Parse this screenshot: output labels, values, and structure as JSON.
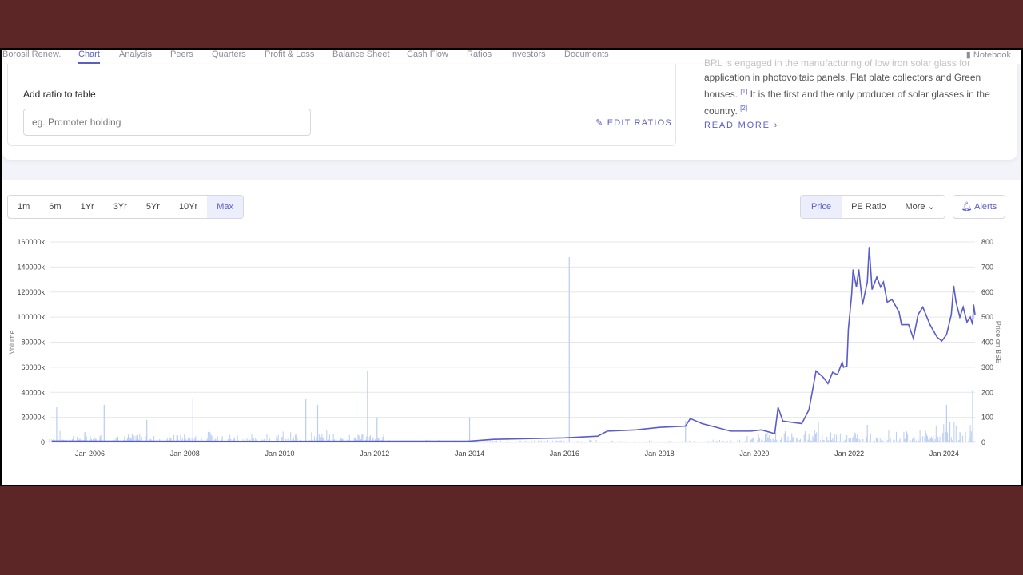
{
  "nav": {
    "items": [
      "Borosil Renew.",
      "Chart",
      "Analysis",
      "Peers",
      "Quarters",
      "Profit & Loss",
      "Balance Sheet",
      "Cash Flow",
      "Ratios",
      "Investors",
      "Documents"
    ],
    "active": "Chart",
    "notebook": "Notebook"
  },
  "ratio": {
    "label": "Add ratio to table",
    "placeholder": "eg. Promoter holding",
    "edit": "EDIT RATIOS"
  },
  "about": {
    "line0": "BRL is engaged in the manufacturing of low iron solar glass for",
    "line1": "application in photovoltaic panels, Flat plate collectors and Green",
    "line2a": "houses.",
    "ref1": "[1]",
    "line2b": " It is the first and the only producer of solar glasses in the",
    "line3": "country.",
    "ref2": "[2]",
    "read_more": "READ MORE"
  },
  "ranges": [
    "1m",
    "6m",
    "1Yr",
    "3Yr",
    "5Yr",
    "10Yr",
    "Max"
  ],
  "range_selected": "Max",
  "metrics": {
    "price": "Price",
    "pe": "PE Ratio",
    "more": "More"
  },
  "metric_selected": "Price",
  "alerts": "Alerts",
  "colors": {
    "accent": "#5a5fc7",
    "price_line": "#5a5cc9",
    "volume": "#b9cdf1"
  },
  "chart_data": {
    "type": "line+bar",
    "ylabel_left": "Volume",
    "ylabel_right": "Price on BSE",
    "xticks": [
      "Jan 2006",
      "Jan 2008",
      "Jan 2010",
      "Jan 2012",
      "Jan 2014",
      "Jan 2016",
      "Jan 2018",
      "Jan 2020",
      "Jan 2022",
      "Jan 2024"
    ],
    "yticks_left": [
      "0",
      "20000k",
      "40000k",
      "60000k",
      "80000k",
      "100000k",
      "120000k",
      "140000k",
      "160000k"
    ],
    "yticks_right": [
      "0",
      "100",
      "200",
      "300",
      "400",
      "500",
      "600",
      "700",
      "800"
    ],
    "xlim": [
      2005.15,
      2024.65
    ],
    "ylim_left": [
      0,
      160000
    ],
    "ylim_right": [
      0,
      800
    ],
    "grid": true,
    "price": [
      [
        2005.2,
        5
      ],
      [
        2010,
        4
      ],
      [
        2014,
        5
      ],
      [
        2014.5,
        12
      ],
      [
        2016,
        18
      ],
      [
        2016.7,
        25
      ],
      [
        2016.9,
        45
      ],
      [
        2017.5,
        50
      ],
      [
        2018,
        60
      ],
      [
        2018.55,
        65
      ],
      [
        2018.65,
        95
      ],
      [
        2018.9,
        75
      ],
      [
        2019.5,
        45
      ],
      [
        2019.93,
        45
      ],
      [
        2020.15,
        50
      ],
      [
        2020.43,
        35
      ],
      [
        2020.5,
        140
      ],
      [
        2020.6,
        85
      ],
      [
        2020.8,
        80
      ],
      [
        2021.0,
        75
      ],
      [
        2021.15,
        130
      ],
      [
        2021.3,
        285
      ],
      [
        2021.45,
        260
      ],
      [
        2021.55,
        235
      ],
      [
        2021.65,
        280
      ],
      [
        2021.75,
        270
      ],
      [
        2021.85,
        320
      ],
      [
        2021.88,
        300
      ],
      [
        2021.95,
        305
      ],
      [
        2021.98,
        450
      ],
      [
        2022.05,
        590
      ],
      [
        2022.08,
        690
      ],
      [
        2022.15,
        620
      ],
      [
        2022.2,
        690
      ],
      [
        2022.28,
        550
      ],
      [
        2022.38,
        640
      ],
      [
        2022.42,
        780
      ],
      [
        2022.48,
        610
      ],
      [
        2022.58,
        660
      ],
      [
        2022.66,
        620
      ],
      [
        2022.72,
        640
      ],
      [
        2022.8,
        560
      ],
      [
        2022.9,
        570
      ],
      [
        2023.05,
        520
      ],
      [
        2023.1,
        470
      ],
      [
        2023.25,
        470
      ],
      [
        2023.35,
        415
      ],
      [
        2023.45,
        510
      ],
      [
        2023.55,
        540
      ],
      [
        2023.7,
        470
      ],
      [
        2023.85,
        420
      ],
      [
        2023.95,
        405
      ],
      [
        2024.05,
        430
      ],
      [
        2024.15,
        510
      ],
      [
        2024.2,
        625
      ],
      [
        2024.25,
        560
      ],
      [
        2024.33,
        500
      ],
      [
        2024.4,
        540
      ],
      [
        2024.48,
        480
      ],
      [
        2024.55,
        500
      ],
      [
        2024.6,
        470
      ],
      [
        2024.62,
        550
      ],
      [
        2024.65,
        510
      ]
    ],
    "volume_spikes": [
      [
        2005.3,
        28000
      ],
      [
        2006.3,
        30000
      ],
      [
        2007.2,
        18000
      ],
      [
        2008.17,
        35000
      ],
      [
        2010.55,
        35000
      ],
      [
        2010.8,
        30000
      ],
      [
        2011.85,
        57000
      ],
      [
        2012.05,
        20000
      ],
      [
        2014.0,
        20000
      ],
      [
        2016.1,
        148000
      ],
      [
        2018.55,
        17000
      ],
      [
        2021.35,
        16000
      ],
      [
        2022.38,
        14000
      ],
      [
        2024.05,
        30000
      ],
      [
        2024.12,
        16000
      ],
      [
        2024.6,
        42000
      ]
    ]
  }
}
